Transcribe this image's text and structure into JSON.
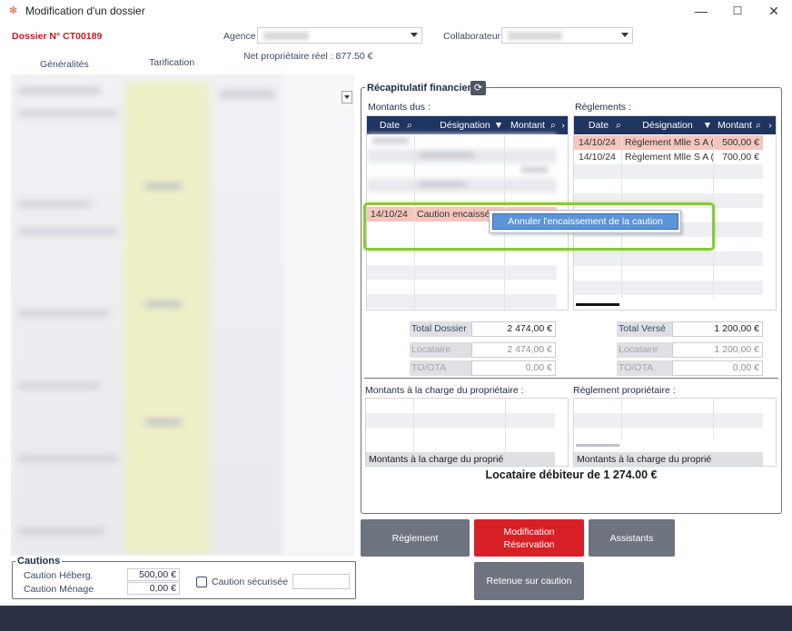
{
  "window": {
    "title": "Modification d'un dossier",
    "icon": "app-logo-icon",
    "controls": {
      "minimize": "—",
      "maximize": "☐",
      "close": "✕"
    }
  },
  "header": {
    "dossier": "Dossier N° CT00189",
    "agence_label": "Agence",
    "collaborateur_label": "Collaborateur",
    "net_proprietaire": "Net propriétaire réel : 877.50 €"
  },
  "tabs": [
    "Généralités",
    "Tarification"
  ],
  "recap": {
    "title": "Récapitulatif financier",
    "refresh_icon": "⟳",
    "montants_dus": {
      "label": "Montants dus :",
      "columns": [
        "Date",
        "Désignation",
        "Montant"
      ],
      "rows": [
        {
          "date": "14/10/24",
          "designation": "Caution encaissée",
          "montant": ""
        }
      ]
    },
    "reglements": {
      "label": "Règlements :",
      "columns": [
        "Date",
        "Désignation",
        "Montant"
      ],
      "rows": [
        {
          "date": "14/10/24",
          "designation": "Règlement Mlle S A ( CT",
          "montant": "500,00 €"
        },
        {
          "date": "14/10/24",
          "designation": "Règlement Mlle S A ( CT",
          "montant": "700,00 €"
        }
      ]
    },
    "totals_left": [
      {
        "label": "Total Dossier",
        "value": "2 474,00 €"
      },
      {
        "label": "Locataire",
        "value": "2 474,00 €"
      },
      {
        "label": "TO/OTA",
        "value": "0,00 €"
      }
    ],
    "totals_right": [
      {
        "label": "Total Versé",
        "value": "1 200,00 €"
      },
      {
        "label": "Locataire",
        "value": "1 200,00 €"
      },
      {
        "label": "TO/OTA",
        "value": "0,00 €"
      }
    ],
    "charge_proprietaire": {
      "label": "Montants à la charge du propriétaire :",
      "footer": "Montants à la charge du proprié"
    },
    "reglement_proprietaire": {
      "label": "Règlement propriétaire :",
      "footer": "Montants à la charge du proprié"
    },
    "debiteur": "Locataire débiteur de 1 274.00 €"
  },
  "context_menu": {
    "item": "Annuler l'encaissement de la caution"
  },
  "buttons": {
    "reglement": "Règlement",
    "modification_1": "Modification",
    "modification_2": "Réservation",
    "assistants": "Assistants",
    "retenue": "Retenue sur caution"
  },
  "cautions": {
    "title": "Cautions",
    "heberg_label": "Caution Héberg.",
    "heberg_value": "500,00 €",
    "menage_label": "Caution Ménage",
    "menage_value": "0,00 €",
    "securisee_label": "Caution sécurisée"
  },
  "colors": {
    "grid_header": "#1f3560",
    "selected_row": "#f6c5bd",
    "accent_red": "#d71f26",
    "button_gray": "#6e7380",
    "highlight_green": "#8dc63f",
    "menu_blue": "#5c95d6"
  }
}
